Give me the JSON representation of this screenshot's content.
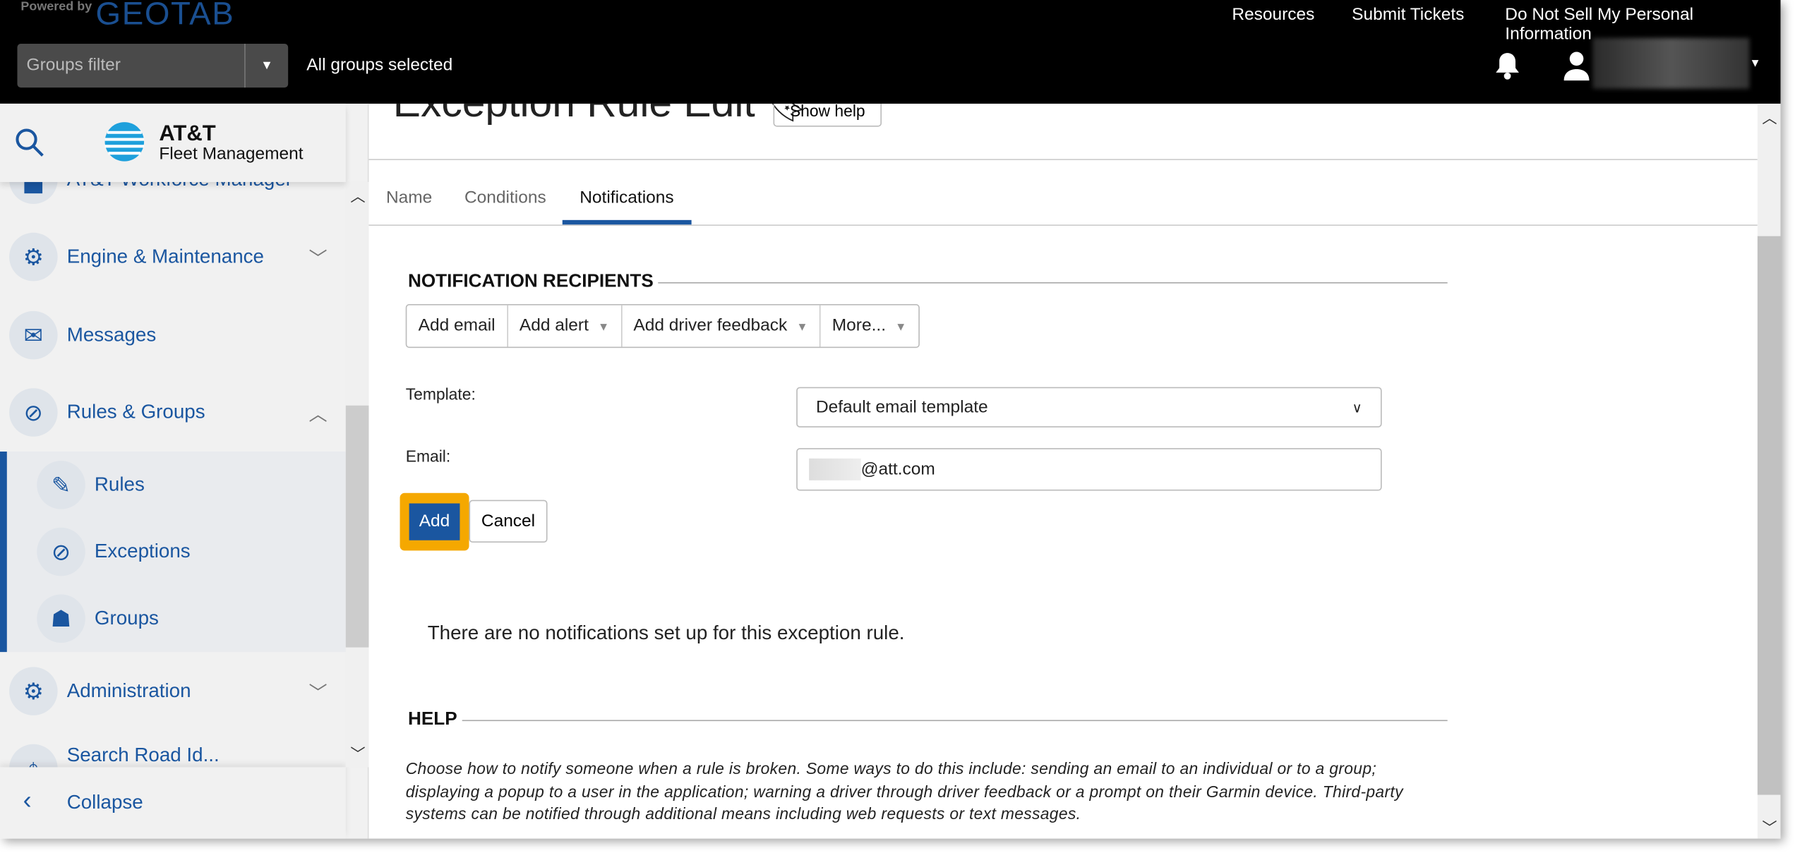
{
  "header": {
    "powered_by": "Powered by",
    "brand": "GEOTAB",
    "links": [
      "Resources",
      "Submit Tickets",
      "Do Not Sell My Personal Information"
    ],
    "groups_filter_placeholder": "Groups filter",
    "groups_status": "All groups selected"
  },
  "sidebar": {
    "logo_line1": "AT&T",
    "logo_line2": "Fleet Management",
    "items": [
      {
        "label": "AT&T Workforce Manager",
        "icon": "building-icon"
      },
      {
        "label": "Engine & Maintenance",
        "icon": "engine-icon"
      },
      {
        "label": "Messages",
        "icon": "envelope-icon"
      },
      {
        "label": "Rules & Groups",
        "icon": "prohibit-icon"
      },
      {
        "label": "Rules",
        "icon": "rules-icon"
      },
      {
        "label": "Exceptions",
        "icon": "prohibit-icon"
      },
      {
        "label": "Groups",
        "icon": "hierarchy-icon"
      },
      {
        "label": "Administration",
        "icon": "gear-icon"
      },
      {
        "label": "Search Road Id...",
        "icon": "map-icon"
      }
    ],
    "collapse": "Collapse"
  },
  "page": {
    "title": "Exception Rule Edit",
    "show_help": "Show help",
    "tabs": [
      {
        "label": "Name"
      },
      {
        "label": "Conditions"
      },
      {
        "label": "Notifications",
        "active": true
      }
    ],
    "recipients_heading": "NOTIFICATION RECIPIENTS",
    "buttons": [
      "Add email",
      "Add alert",
      "Add driver feedback",
      "More..."
    ],
    "template_label": "Template:",
    "template_value": "Default email template",
    "email_label": "Email:",
    "email_value": "@att.com",
    "add": "Add",
    "cancel": "Cancel",
    "empty": "There are no notifications set up for this exception rule.",
    "help_heading": "HELP",
    "help_text": "Choose how to notify someone when a rule is broken. Some ways to do this include: sending an email to an individual or to a group; displaying a popup to a user in the application; warning a driver through driver feedback or a prompt on their Garmin device. Third-party systems can be notified through additional means including web requests or text messages."
  },
  "colors": {
    "accent": "#1a56a0",
    "highlight": "#f5a800",
    "header": "#000000"
  }
}
